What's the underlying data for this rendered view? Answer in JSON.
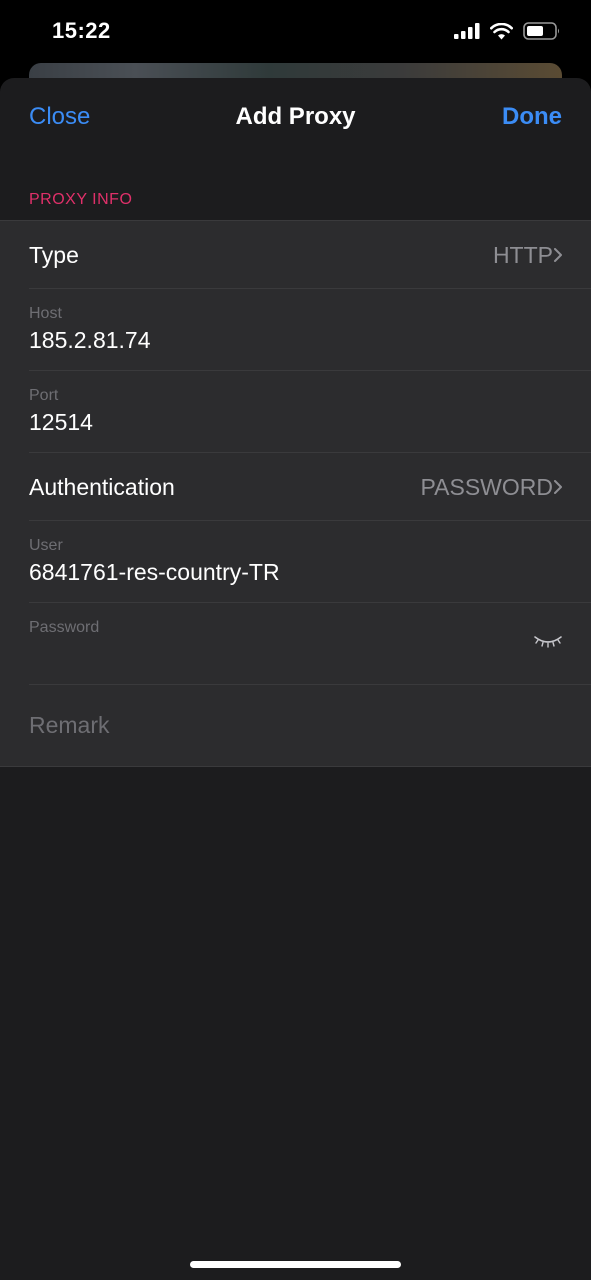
{
  "status_bar": {
    "time": "15:22",
    "icons": [
      "signal-icon",
      "wifi-icon",
      "battery-icon"
    ]
  },
  "nav": {
    "close_label": "Close",
    "title": "Add Proxy",
    "done_label": "Done"
  },
  "section": {
    "header": "PROXY INFO"
  },
  "rows": {
    "type": {
      "label": "Type",
      "value": "HTTP"
    },
    "host": {
      "caption": "Host",
      "value": "185.2.81.74"
    },
    "port": {
      "caption": "Port",
      "value": "12514"
    },
    "authentication": {
      "label": "Authentication",
      "value": "PASSWORD"
    },
    "user": {
      "caption": "User",
      "value": "6841761-res-country-TR"
    },
    "password": {
      "caption": "Password",
      "value": ""
    },
    "remark": {
      "placeholder": "Remark"
    }
  },
  "colors": {
    "accent": "#3b8cf5",
    "section_header": "#e0306a",
    "sheet_background": "#1c1c1e",
    "cell_background": "#2c2c2e"
  }
}
